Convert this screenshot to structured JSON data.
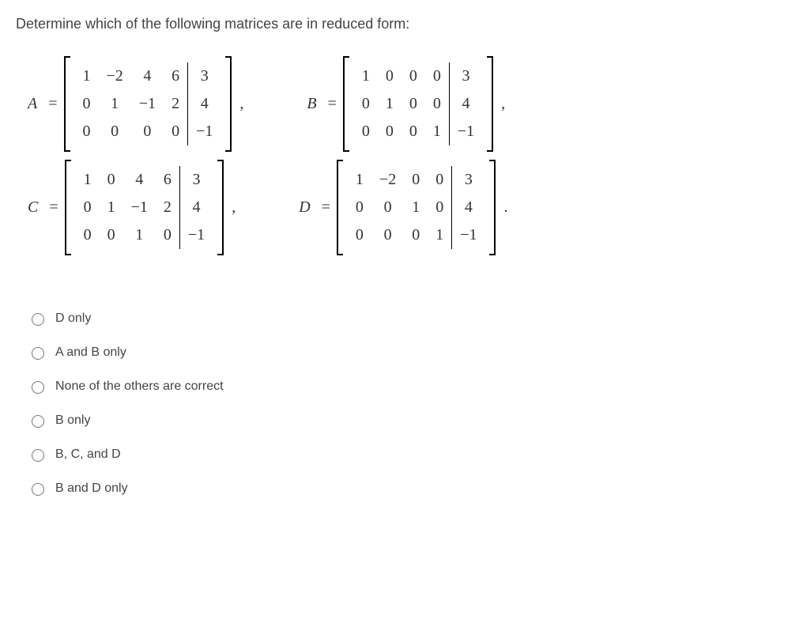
{
  "question": "Determine which of the following matrices are in reduced form:",
  "matrices": {
    "A": {
      "label": "A",
      "punct": ",",
      "rows": [
        [
          "1",
          "−2",
          "4",
          "6",
          "3"
        ],
        [
          "0",
          "1",
          "−1",
          "2",
          "4"
        ],
        [
          "0",
          "0",
          "0",
          "0",
          "−1"
        ]
      ]
    },
    "B": {
      "label": "B",
      "punct": ",",
      "rows": [
        [
          "1",
          "0",
          "0",
          "0",
          "3"
        ],
        [
          "0",
          "1",
          "0",
          "0",
          "4"
        ],
        [
          "0",
          "0",
          "0",
          "1",
          "−1"
        ]
      ]
    },
    "C": {
      "label": "C",
      "punct": ",",
      "rows": [
        [
          "1",
          "0",
          "4",
          "6",
          "3"
        ],
        [
          "0",
          "1",
          "−1",
          "2",
          "4"
        ],
        [
          "0",
          "0",
          "1",
          "0",
          "−1"
        ]
      ]
    },
    "D": {
      "label": "D",
      "punct": ".",
      "rows": [
        [
          "1",
          "−2",
          "0",
          "0",
          "3"
        ],
        [
          "0",
          "0",
          "1",
          "0",
          "4"
        ],
        [
          "0",
          "0",
          "0",
          "1",
          "−1"
        ]
      ]
    }
  },
  "options": [
    "D only",
    "A and B only",
    "None of the others are correct",
    "B only",
    "B, C, and D",
    "B and D only"
  ]
}
